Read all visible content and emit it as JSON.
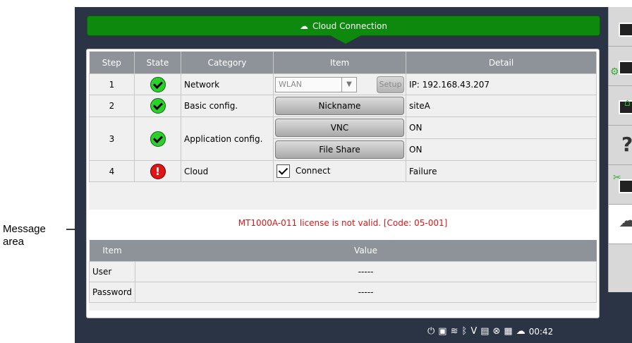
{
  "annotation": {
    "message_area_label": "Message\narea"
  },
  "title": "Cloud Connection",
  "steps_table": {
    "headers": [
      "Step",
      "State",
      "Category",
      "Item",
      "Detail"
    ],
    "rows": [
      {
        "step": "1",
        "state": "ok",
        "category": "Network",
        "select_value": "WLAN",
        "setup_label": "Setup",
        "detail": "IP: 192.168.43.207"
      },
      {
        "step": "2",
        "state": "ok",
        "category": "Basic config.",
        "item": "Nickname",
        "detail": "siteA"
      },
      {
        "step": "3",
        "state": "ok",
        "category": "Application config.",
        "item_a": "VNC",
        "detail_a": "ON",
        "item_b": "File Share",
        "detail_b": "ON"
      },
      {
        "step": "4",
        "state": "error",
        "category": "Cloud",
        "checkbox_label": "Connect",
        "detail": "Failure"
      }
    ]
  },
  "message": "MT1000A-011 license is not valid. [Code: 05-001]",
  "values_table": {
    "headers": [
      "Item",
      "Value"
    ],
    "rows": [
      {
        "item": "User",
        "value": "-----"
      },
      {
        "item": "Password",
        "value": "-----"
      }
    ]
  },
  "sidebar_icons": [
    "folder-open-icon",
    "folder-settings-icon",
    "folder-home-icon",
    "help-icon",
    "tools-icon",
    "cloud-upload-icon"
  ],
  "status_bar": {
    "time": "00:42",
    "error_glyph": "!"
  },
  "colors": {
    "title_green": "#0d8a0d",
    "error_red": "#e01515",
    "ok_green": "#2bd12b",
    "header_gray": "#8e9399"
  }
}
